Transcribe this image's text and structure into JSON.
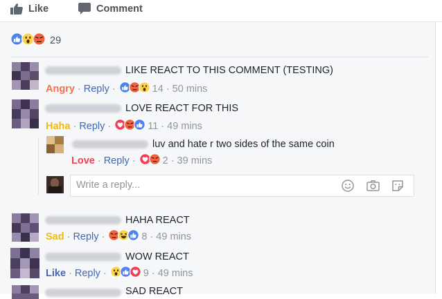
{
  "actions": {
    "like": "Like",
    "comment": "Comment"
  },
  "summary": {
    "count": "29",
    "reactions": [
      "like",
      "wow",
      "angry"
    ]
  },
  "comments": [
    {
      "text": "LIKE REACT TO THIS COMMENT (TESTING)",
      "reaction": "Angry",
      "reaction_color": "#f7714c",
      "reply": "Reply",
      "count": "14",
      "time": "50 mins",
      "icons": [
        "like",
        "angry",
        "wow"
      ]
    },
    {
      "text": "LOVE REACT FOR THIS",
      "reaction": "Haha",
      "reaction_color": "#f0ba15",
      "reply": "Reply",
      "count": "11",
      "time": "49 mins",
      "icons": [
        "love",
        "angry",
        "like"
      ]
    },
    {
      "text": "luv and hate r two sides of the same coin",
      "reaction": "Love",
      "reaction_color": "#f33e58",
      "reply": "Reply",
      "count": "2",
      "time": "39 mins",
      "icons": [
        "love",
        "angry"
      ]
    },
    {
      "text": "HAHA REACT",
      "reaction": "Sad",
      "reaction_color": "#f0ba15",
      "reply": "Reply",
      "count": "8",
      "time": "49 mins",
      "icons": [
        "angry",
        "haha",
        "like"
      ]
    },
    {
      "text": "WOW REACT",
      "reaction": "Like",
      "reaction_color": "#4267b2",
      "reply": "Reply",
      "count": "9",
      "time": "49 mins",
      "icons": [
        "wow",
        "like",
        "love"
      ]
    },
    {
      "text": "SAD REACT"
    }
  ],
  "reply_box": {
    "placeholder": "Write a reply..."
  },
  "icons": {
    "like_action": "thumbs-up-icon",
    "comment_action": "comment-bubble-icon",
    "reply_box": [
      "emoji-icon",
      "camera-icon",
      "sticker-icon"
    ]
  },
  "colors": {
    "link": "#4267b2",
    "meta": "#90949c",
    "like": "#4267b2",
    "love": "#f33e58",
    "angry": "#f7714c",
    "haha": "#f0ba15",
    "panel_bg": "#f6f7f9"
  }
}
